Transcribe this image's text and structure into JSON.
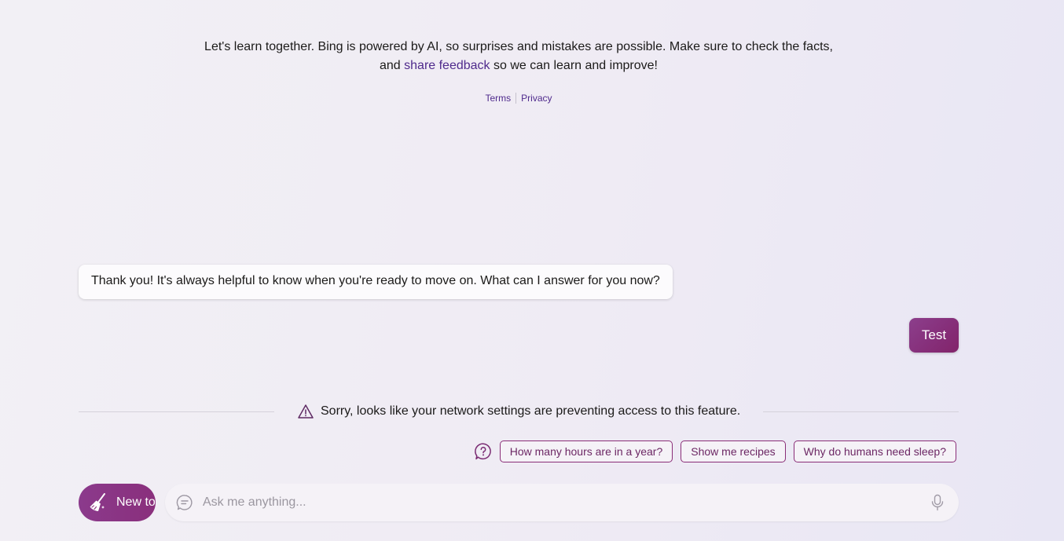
{
  "disclaimer": {
    "part1": "Let's learn together. Bing is powered by AI, so surprises and mistakes are possible. Make sure to check the facts, and ",
    "link": "share feedback",
    "part2": " so we can learn and improve!"
  },
  "legal": {
    "terms": "Terms",
    "privacy": "Privacy"
  },
  "conversation": {
    "bot_message": "Thank you! It's always helpful to know when you're ready to move on. What can I answer for you now?",
    "user_message": "Test"
  },
  "notice": {
    "icon": "warning-icon",
    "text": "Sorry, looks like your network settings are preventing access to this feature."
  },
  "suggestions": {
    "icon": "help-bubble-icon",
    "items": [
      "How many hours are in a year?",
      "Show me recipes",
      "Why do humans need sleep?"
    ]
  },
  "composer": {
    "new_topic_label": "New to",
    "new_topic_icon": "broom-icon",
    "placeholder": "Ask me anything...",
    "chat_icon": "chat-bubble-icon",
    "mic_icon": "microphone-icon"
  },
  "colors": {
    "accent": "#8a2f7c",
    "link": "#4f2a8c",
    "chip_text": "#6c2764"
  }
}
